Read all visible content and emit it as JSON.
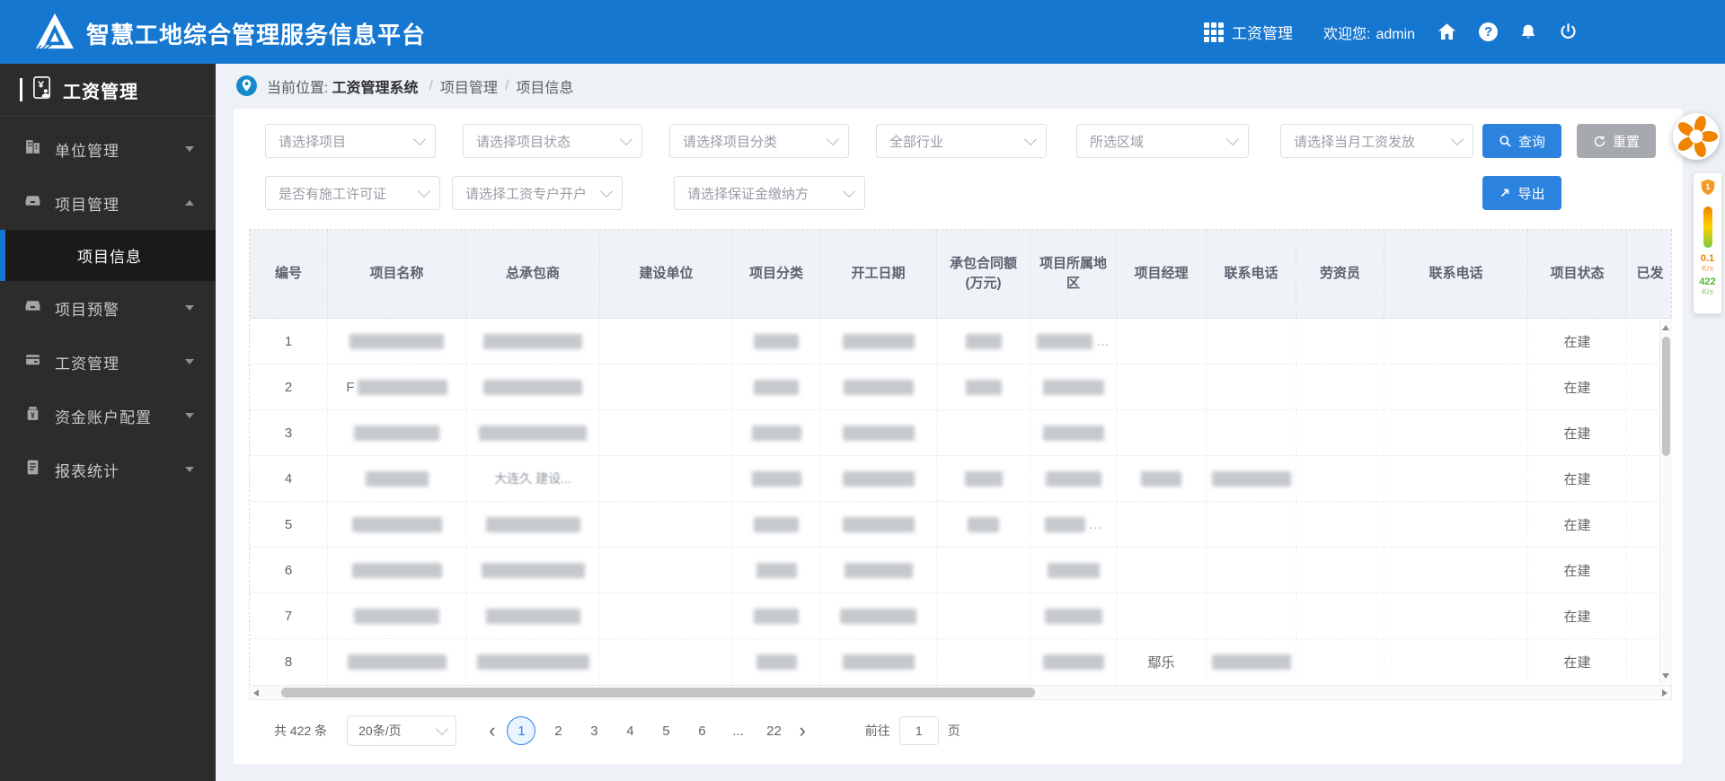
{
  "topbar": {
    "title": "智慧工地综合管理服务信息平台",
    "app_label": "工资管理",
    "welcome_label": "欢迎您:",
    "username": "admin"
  },
  "sidebar": {
    "title": "工资管理",
    "items": [
      {
        "label": "单位管理",
        "expanded": false
      },
      {
        "label": "项目管理",
        "expanded": true
      },
      {
        "label": "项目预警",
        "expanded": false
      },
      {
        "label": "工资管理",
        "expanded": false
      },
      {
        "label": "资金账户配置",
        "expanded": false
      },
      {
        "label": "报表统计",
        "expanded": false
      }
    ],
    "submenu": {
      "label": "项目信息",
      "active": true
    }
  },
  "breadcrumb": {
    "prefix": "当前位置:",
    "root": "工资管理系统",
    "sep1": "/",
    "level1": "项目管理",
    "sep2": "/",
    "level2": "项目信息"
  },
  "filters": {
    "row1": [
      "请选择项目",
      "请选择项目状态",
      "请选择项目分类",
      "全部行业",
      "所选区域",
      "请选择当月工资发放"
    ],
    "row2": [
      "是否有施工许可证",
      "请选择工资专户开户",
      "请选择保证金缴纳方"
    ],
    "query": "查询",
    "reset": "重置",
    "export": "导出"
  },
  "table": {
    "columns": [
      "编号",
      "项目名称",
      "总承包商",
      "建设单位",
      "项目分类",
      "开工日期",
      "承包合同额(万元)",
      "项目所属地区",
      "项目经理",
      "联系电话",
      "劳资员",
      "联系电话",
      "项目状态",
      "已发"
    ],
    "rows": [
      {
        "no": "1",
        "name": {
          "b": 105
        },
        "contractor": {
          "b": 110
        },
        "category": {
          "b": 50
        },
        "start_date": {
          "b": 80
        },
        "amount": {
          "b": 40
        },
        "region": {
          "b": 62,
          "suf": "…"
        },
        "status": "在建"
      },
      {
        "no": "2",
        "name": {
          "pre": "F",
          "b": 100
        },
        "contractor": {
          "b": 110
        },
        "category": {
          "b": 50
        },
        "start_date": {
          "b": 78
        },
        "amount": {
          "b": 40
        },
        "region": {
          "b": 68
        },
        "status": "在建"
      },
      {
        "no": "3",
        "name": {
          "b": 95
        },
        "contractor": {
          "b": 120
        },
        "category": {
          "b": 55
        },
        "start_date": {
          "b": 80
        },
        "region": {
          "b": 68
        },
        "status": "在建"
      },
      {
        "no": "4",
        "name": {
          "b": 70
        },
        "contractor": {
          "t": "大连久  建设..."
        },
        "category": {
          "b": 55
        },
        "start_date": {
          "b": 80
        },
        "amount": {
          "b": 42
        },
        "region": {
          "b": 62
        },
        "manager": {
          "b": 45
        },
        "manager_phone": {
          "b": 88
        },
        "status": "在建"
      },
      {
        "no": "5",
        "name": {
          "b": 100
        },
        "contractor": {
          "b": 105
        },
        "category": {
          "b": 50
        },
        "start_date": {
          "b": 80
        },
        "amount": {
          "b": 35
        },
        "region": {
          "b": 45,
          "suf": "…"
        },
        "status": "在建"
      },
      {
        "no": "6",
        "name": {
          "b": 100
        },
        "contractor": {
          "b": 115
        },
        "category": {
          "b": 45
        },
        "start_date": {
          "b": 76
        },
        "region": {
          "b": 58
        },
        "status": "在建"
      },
      {
        "no": "7",
        "name": {
          "b": 95
        },
        "contractor": {
          "b": 105
        },
        "category": {
          "b": 50
        },
        "start_date": {
          "b": 85
        },
        "region": {
          "b": 64
        },
        "status": "在建"
      },
      {
        "no": "8",
        "name": {
          "b": 110
        },
        "contractor": {
          "b": 125
        },
        "category": {
          "b": 45
        },
        "start_date": {
          "b": 80
        },
        "region": {
          "b": 68
        },
        "manager": "鄢乐",
        "manager_phone": {
          "b": 88
        },
        "status": "在建"
      }
    ]
  },
  "pagination": {
    "total": "共 422 条",
    "page_size": "20条/页",
    "pages": [
      "1",
      "2",
      "3",
      "4",
      "5",
      "6",
      "...",
      "22"
    ],
    "active_page": "1",
    "goto_label": "前往",
    "goto_value": "1",
    "unit_label": "页"
  },
  "widget": {
    "badge": "1",
    "up_value": "0.1",
    "up_unit": "K/s",
    "down_value": "422",
    "down_unit": "K/s"
  },
  "colors": {
    "header_blue": "#1677d0",
    "button_blue": "#2b82df",
    "sidebar_dark": "#2c2c2c"
  }
}
